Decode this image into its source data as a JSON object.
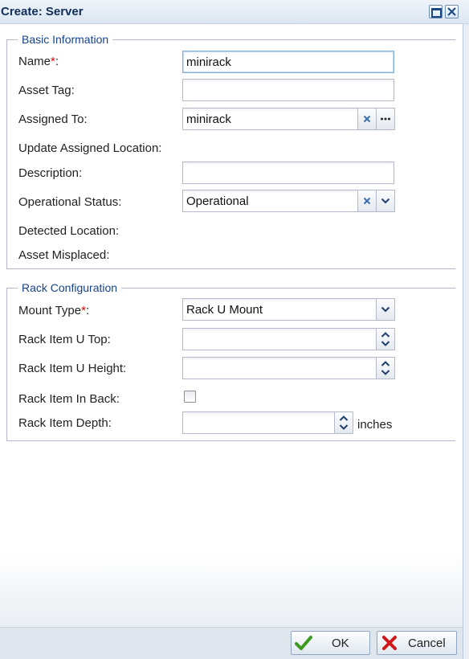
{
  "window": {
    "title": "Create: Server"
  },
  "basic": {
    "legend": "Basic Information",
    "name": {
      "label": "Name",
      "required_mark": "*",
      "colon": ":",
      "value": "minirack"
    },
    "asset_tag": {
      "label": "Asset Tag:",
      "value": ""
    },
    "assigned_to": {
      "label": "Assigned To:",
      "value": "minirack",
      "clear_icon": "clear-x-icon",
      "browse_icon": "ellipsis-icon"
    },
    "update_location": {
      "label": "Update Assigned Location:"
    },
    "description": {
      "label": "Description:",
      "value": ""
    },
    "operational_status": {
      "label": "Operational Status:",
      "value": "Operational"
    },
    "detected_location": {
      "label": "Detected Location:"
    },
    "asset_misplaced": {
      "label": "Asset Misplaced:"
    }
  },
  "rack": {
    "legend": "Rack Configuration",
    "mount_type": {
      "label": "Mount Type",
      "required_mark": "*",
      "colon": ":",
      "value": "Rack U Mount"
    },
    "u_top": {
      "label": "Rack Item U Top:",
      "value": ""
    },
    "u_height": {
      "label": "Rack Item U Height:",
      "value": ""
    },
    "in_back": {
      "label": "Rack Item In Back:",
      "checked": false
    },
    "depth": {
      "label": "Rack Item Depth:",
      "value": "",
      "unit": "inches"
    }
  },
  "buttons": {
    "ok": "OK",
    "cancel": "Cancel"
  },
  "colors": {
    "title": "#0f2f5a",
    "legend": "#15428b",
    "required": "#e00000",
    "ok_check": "#3c9a1e",
    "cancel_x": "#d01818"
  }
}
